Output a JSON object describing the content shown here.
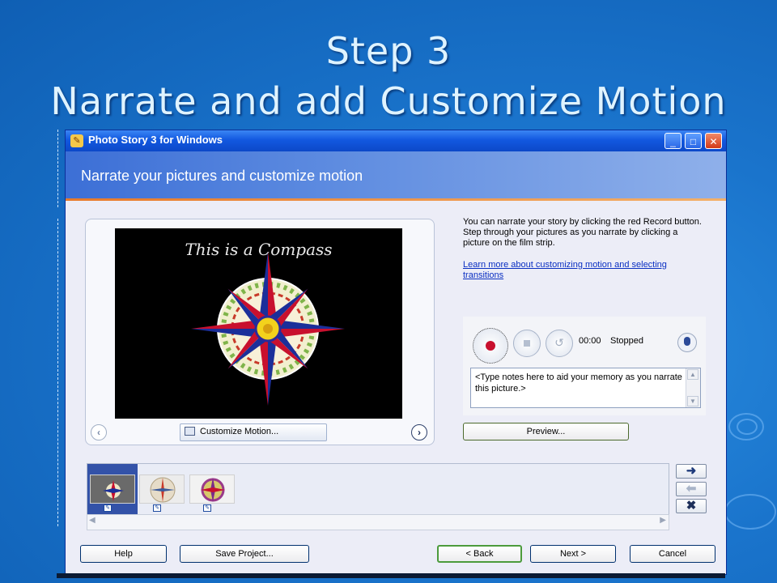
{
  "slide": {
    "title_line1": "Step 3",
    "title_line2": "Narrate and add Customize Motion"
  },
  "window": {
    "title": "Photo Story 3 for Windows",
    "header": "Narrate your pictures and customize motion",
    "controls": {
      "minimize": "_",
      "maximize": "□",
      "close": "✕"
    }
  },
  "preview": {
    "image_caption": "This is a Compass",
    "customize_motion_label": "Customize Motion...",
    "prev_icon": "chevron-left-icon",
    "next_icon": "chevron-right-icon"
  },
  "info": {
    "text": "You can narrate your story by clicking the red Record button. Step through your pictures as you narrate by clicking a picture on the film strip.",
    "link": "Learn more about customizing motion and selecting transitions"
  },
  "recorder": {
    "time": "00:00",
    "status": "Stopped",
    "notes_placeholder": "<Type notes here to aid your memory as you narrate this picture.>",
    "preview_label": "Preview..."
  },
  "filmstrip": {
    "thumbnails": [
      "compass-1",
      "compass-2",
      "compass-3"
    ],
    "selected_index": 0,
    "arrows": {
      "right": "➜",
      "left": "⬅",
      "remove": "✖"
    }
  },
  "footer": {
    "help": "Help",
    "save_project": "Save Project...",
    "back": "< Back",
    "next": "Next >",
    "cancel": "Cancel"
  },
  "colors": {
    "background": "#1a74cc",
    "title_text": "#dff3ff",
    "titlebar": "#1258e0",
    "record_red": "#c8102e"
  }
}
